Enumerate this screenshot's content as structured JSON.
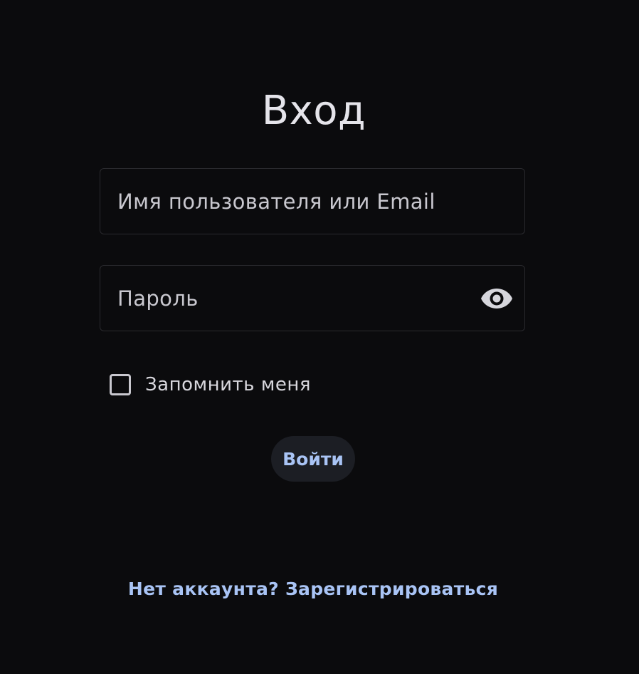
{
  "form": {
    "title": "Вход",
    "username": {
      "placeholder": "Имя пользователя или Email",
      "value": ""
    },
    "password": {
      "placeholder": "Пароль",
      "value": "",
      "toggle_icon": "eye-icon"
    },
    "remember_me": {
      "label": "Запомнить меня",
      "checked": false
    },
    "submit_label": "Войти",
    "register_link": "Нет аккаунта? Зарегистрироваться"
  },
  "colors": {
    "background": "#0b0b0d",
    "accent": "#a9c4f5",
    "button_bg": "#1c1e24",
    "text": "#e5e4ea"
  }
}
